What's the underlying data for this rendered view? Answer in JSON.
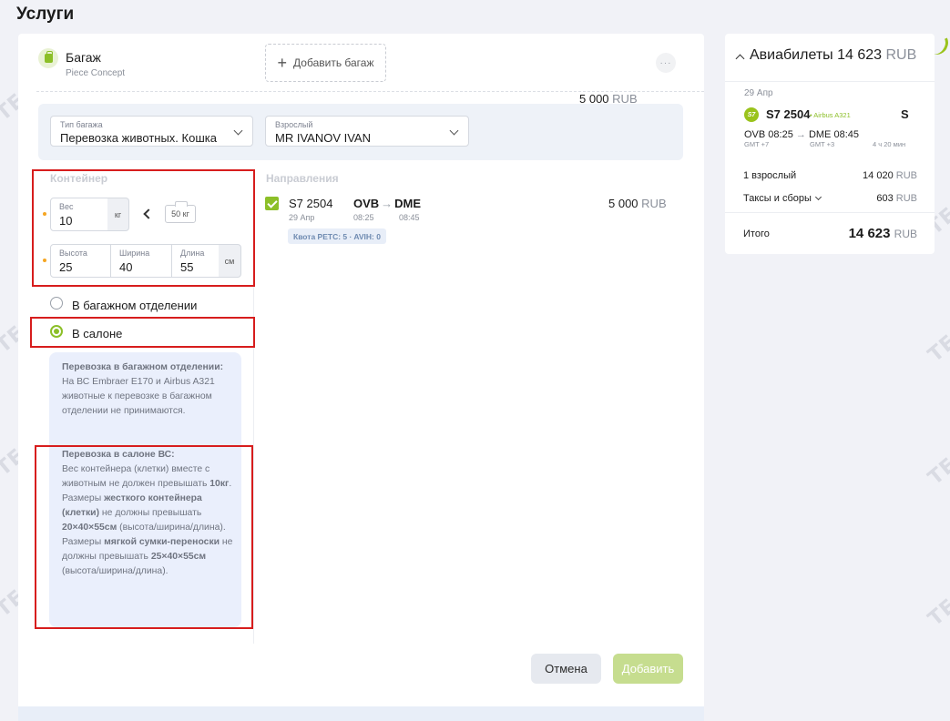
{
  "page_title": "Услуги",
  "watermark": "TEST",
  "baggage": {
    "title": "Багаж",
    "subtitle": "Piece Concept",
    "add_label": "Добавить багаж",
    "more_label": "···"
  },
  "selectors": {
    "type": {
      "label": "Тип багажа",
      "value": "Перевозка животных. Кошка"
    },
    "passenger": {
      "label": "Взрослый",
      "value": "MR IVANOV IVAN"
    },
    "price": "5 000",
    "currency": "RUB"
  },
  "container": {
    "section_label": "Контейнер",
    "weight": {
      "label": "Вес",
      "value": "10",
      "unit": "кг"
    },
    "weight_limit": "50 кг",
    "height": {
      "label": "Высота",
      "value": "25"
    },
    "width": {
      "label": "Ширина",
      "value": "40"
    },
    "length": {
      "label": "Длина",
      "value": "55"
    },
    "dims_unit": "см"
  },
  "placement": {
    "options": [
      {
        "label": "В багажном отделении",
        "selected": false
      },
      {
        "label": "В салоне",
        "selected": true
      }
    ]
  },
  "info": {
    "hold_title": "Перевозка в багажном отделении:",
    "hold_text": "На ВС Embraer E170 и Airbus A321 животные к перевозке в багажном отделении не принимаются.",
    "cabin_title": "Перевозка в салоне ВС:",
    "cabin_text_1": "Вес контейнера (клетки) вместе с животным не должен превышать",
    "cabin_weight": "10кг",
    "cabin_text_2": "Размеры",
    "cabin_hard": "жесткого контейнера (клетки)",
    "cabin_text_3": "не должны превышать",
    "cabin_hard_dims": "20×40×55см",
    "cabin_text_4": "(высота/ширина/длина).",
    "cabin_text_5": "Размеры",
    "cabin_soft": "мягкой сумки-переноски",
    "cabin_text_6": "не должны превышать",
    "cabin_soft_dims": "25×40×55см",
    "cabin_text_7": "(высота/ширина/длина)."
  },
  "directions": {
    "section_label": "Направления",
    "flight_no": "S7  2504",
    "date": "29 Апр",
    "from": "OVB",
    "to": "DME",
    "dep_time": "08:25",
    "arr_time": "08:45",
    "quota": "Квота PETC: 5 · AVIH: 0",
    "price": "5 000",
    "currency": "RUB"
  },
  "buttons": {
    "cancel": "Отмена",
    "add": "Добавить"
  },
  "sidebar": {
    "title": "Авиабилеты",
    "total_top": "14 623",
    "currency": "RUB",
    "date": "29 Апр",
    "airline_logo": "S7",
    "flight": "S7 2504",
    "aircraft": "• Airbus A321",
    "class": "S",
    "route_from": "OVB 08:25",
    "route_to": "DME 08:45",
    "gmt_from": "GMT +7",
    "gmt_to": "GMT +3",
    "duration": "4 ч 20 мин",
    "adults_label": "1 взрослый",
    "adults_value": "14 020",
    "taxes_label": "Таксы и сборы",
    "taxes_value": "603",
    "total_label": "Итого",
    "total_value": "14 623"
  },
  "colors": {
    "accent": "#8cbf28",
    "highlight": "#d71d1d",
    "info_bg": "#eaeffc"
  }
}
